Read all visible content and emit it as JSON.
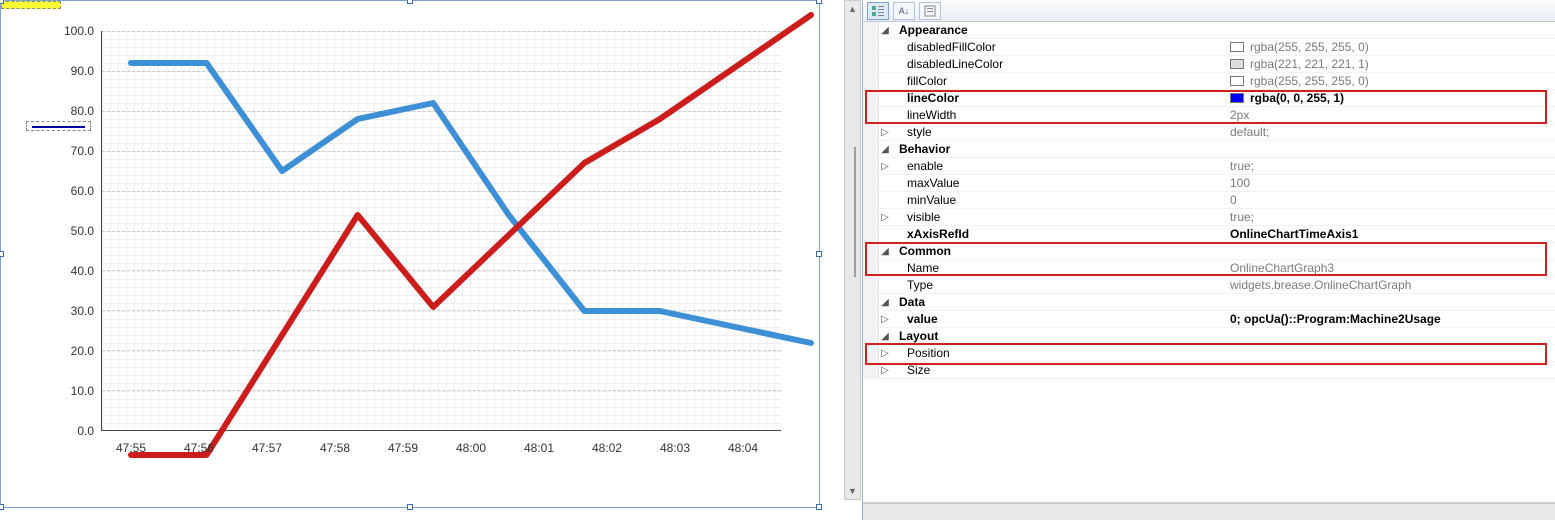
{
  "chart_data": {
    "type": "line",
    "x": [
      "47:55",
      "47:56",
      "47:57",
      "47:58",
      "47:59",
      "48:00",
      "48:01",
      "48:02",
      "48:03",
      "48:04"
    ],
    "ylim": [
      0,
      100
    ],
    "yticks": [
      0,
      10,
      20,
      30,
      40,
      50,
      60,
      70,
      80,
      90,
      100
    ],
    "series": [
      {
        "name": "blue",
        "color": "#3d8fd6",
        "values": [
          92,
          92,
          65,
          78,
          82,
          54,
          30,
          30,
          26,
          22
        ]
      },
      {
        "name": "red",
        "color": "#cc1d1d",
        "values": [
          -6,
          -6,
          24,
          54,
          31,
          49,
          67,
          78,
          91,
          104
        ]
      }
    ],
    "xlabel": "",
    "ylabel": "",
    "title": ""
  },
  "yticks": {
    "t0": "0.0",
    "t1": "10.0",
    "t2": "20.0",
    "t3": "30.0",
    "t4": "40.0",
    "t5": "50.0",
    "t6": "60.0",
    "t7": "70.0",
    "t8": "80.0",
    "t9": "90.0",
    "t10": "100.0"
  },
  "xticks": {
    "x0": "47:55",
    "x1": "47:56",
    "x2": "47:57",
    "x3": "47:58",
    "x4": "47:59",
    "x5": "48:00",
    "x6": "48:01",
    "x7": "48:02",
    "x8": "48:03",
    "x9": "48:04"
  },
  "categories": {
    "appearance": "Appearance",
    "behavior": "Behavior",
    "common": "Common",
    "data": "Data",
    "layout": "Layout"
  },
  "props": {
    "disabledFillColor": {
      "label": "disabledFillColor",
      "value": "rgba(255, 255, 255, 0)",
      "swatch": "#ffffff"
    },
    "disabledLineColor": {
      "label": "disabledLineColor",
      "value": "rgba(221, 221, 221, 1)",
      "swatch": "#dddddd"
    },
    "fillColor": {
      "label": "fillColor",
      "value": "rgba(255, 255, 255, 0)",
      "swatch": "#ffffff"
    },
    "lineColor": {
      "label": "lineColor",
      "value": "rgba(0, 0, 255, 1)",
      "swatch": "#0000ff"
    },
    "lineWidth": {
      "label": "lineWidth",
      "value": "2px"
    },
    "style": {
      "label": "style",
      "value": "default;"
    },
    "enable": {
      "label": "enable",
      "value": "true;"
    },
    "maxValue": {
      "label": "maxValue",
      "value": "100"
    },
    "minValue": {
      "label": "minValue",
      "value": "0"
    },
    "visible": {
      "label": "visible",
      "value": "true;"
    },
    "xAxisRefId": {
      "label": "xAxisRefId",
      "value": "OnlineChartTimeAxis1"
    },
    "name": {
      "label": "Name",
      "value": "OnlineChartGraph3"
    },
    "type": {
      "label": "Type",
      "value": "widgets.brease.OnlineChartGraph"
    },
    "value": {
      "label": "value",
      "value": "0; opcUa()::Program:Machine2Usage"
    },
    "position": {
      "label": "Position",
      "value": ""
    },
    "size": {
      "label": "Size",
      "value": ""
    }
  },
  "description": {
    "label": "disabledFillColor"
  }
}
